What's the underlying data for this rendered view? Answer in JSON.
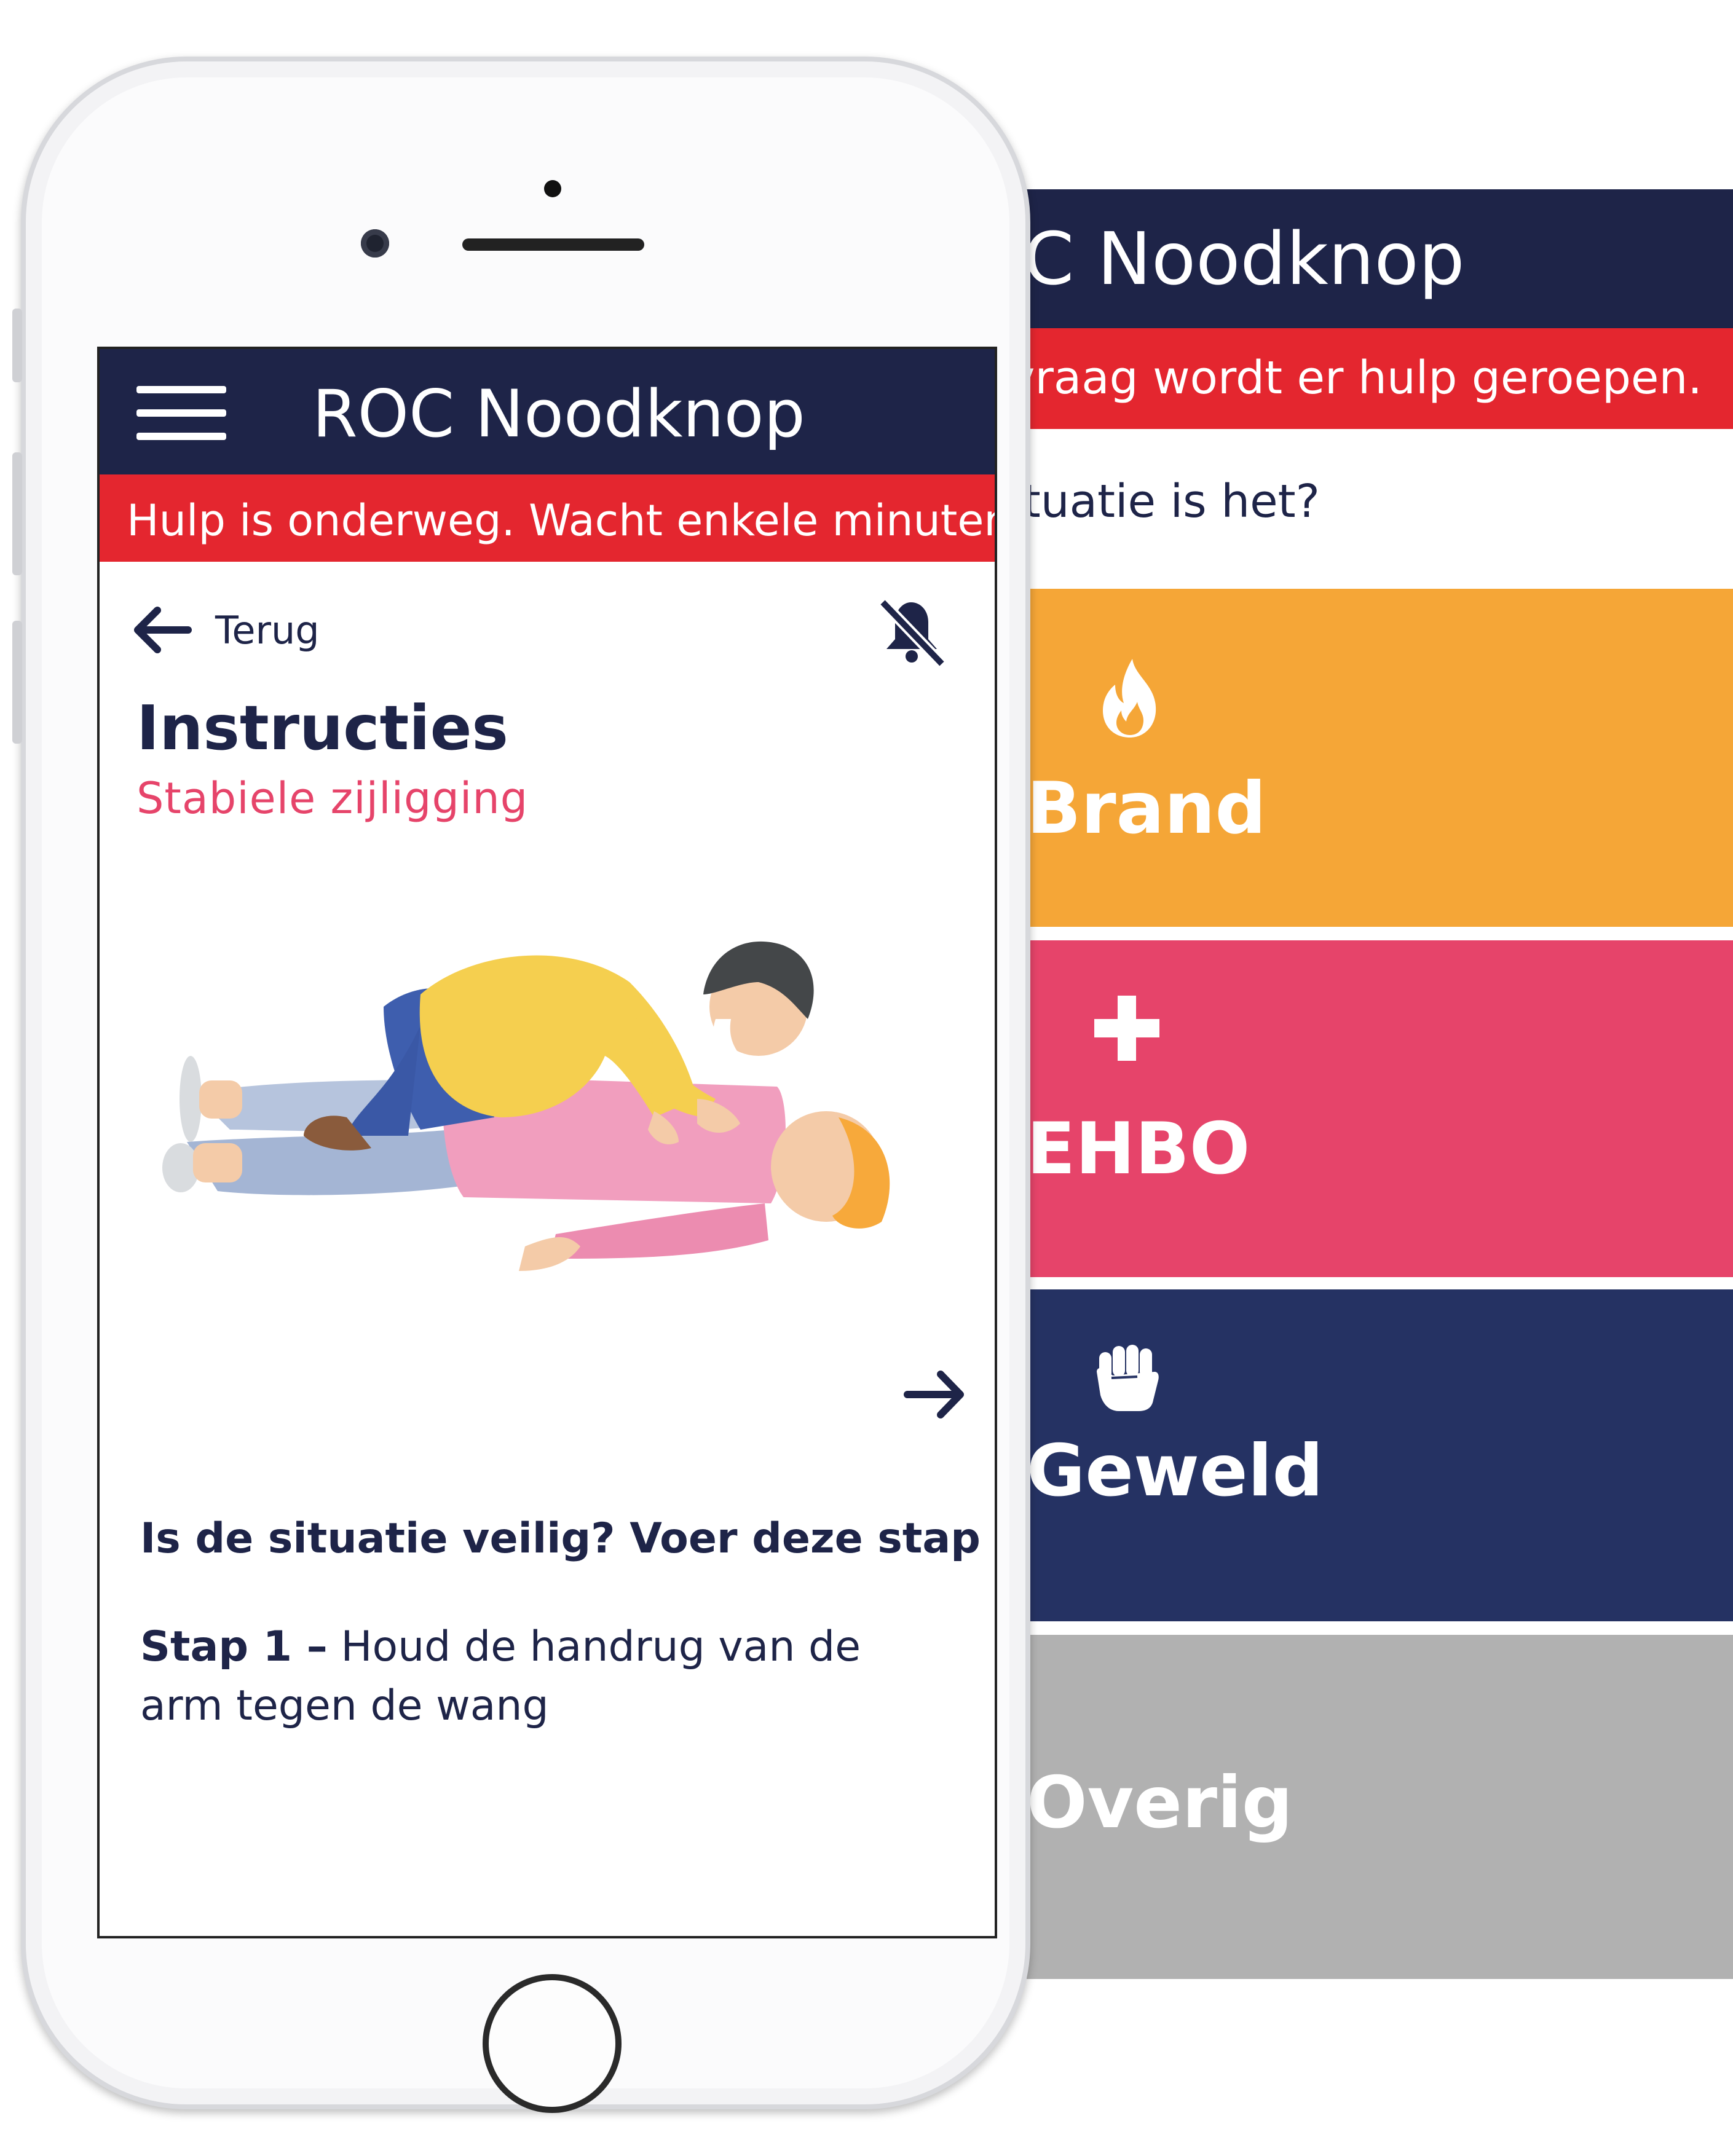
{
  "app": {
    "title": "ROC Noodknop"
  },
  "back_screen": {
    "title": "ROC Noodknop",
    "alert": "Op uw vraag wordt er hulp geroepen.",
    "question": "Wat voor situatie is het?",
    "categories": [
      {
        "label": "Brand",
        "icon": "flame-icon",
        "color": "#f5a637"
      },
      {
        "label": "EHBO",
        "icon": "plus-icon",
        "color": "#e6446a"
      },
      {
        "label": "Geweld",
        "icon": "fist-icon",
        "color": "#253263"
      },
      {
        "label": "Overig",
        "icon": "",
        "color": "#b1b1b1"
      }
    ]
  },
  "front_screen": {
    "title": "ROC Noodknop",
    "alert": "Hulp is onderweg. Wacht enkele minuten.",
    "back_label": "Terug",
    "heading": "Instructies",
    "subheading": "Stabiele zijligging",
    "question": "Is de situatie veilig? Voer deze stap uit.",
    "step_label": "Stap 1 –",
    "step_text": "Houd de handrug van de arm tegen de wang",
    "icons": [
      "menu-icon",
      "arrow-left-icon",
      "mute-icon",
      "arrow-right-icon"
    ]
  },
  "colors": {
    "navy": "#1e2448",
    "alert_red": "#e4262f",
    "accent_pink": "#e6446a",
    "brand_orange": "#f5a637",
    "geweld_blue": "#253263",
    "overig_gray": "#b1b1b1"
  }
}
